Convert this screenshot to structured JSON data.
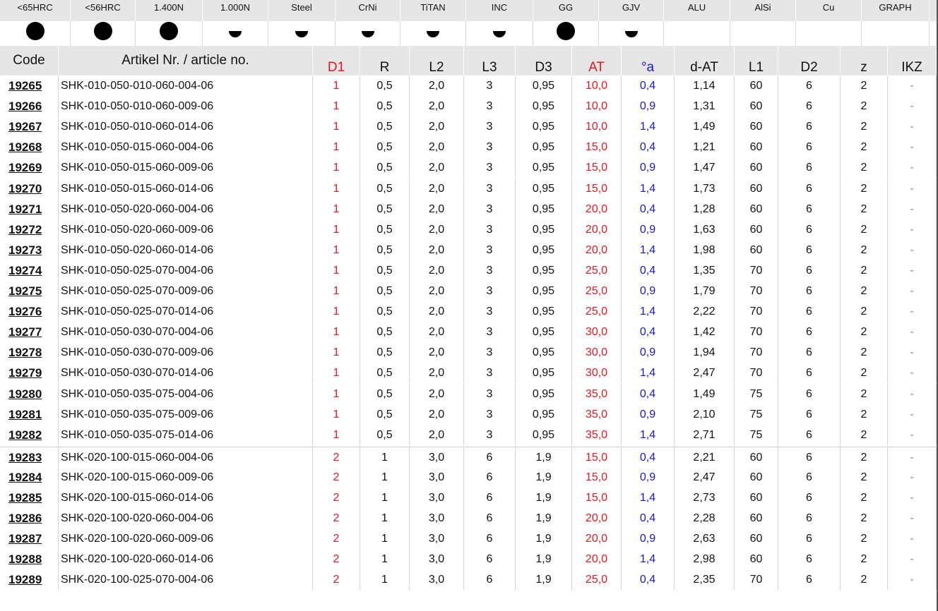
{
  "materials": [
    {
      "label": "<65HRC",
      "rating": "full"
    },
    {
      "label": "<56HRC",
      "rating": "full"
    },
    {
      "label": "1.400N",
      "rating": "full"
    },
    {
      "label": "1.000N",
      "rating": "half"
    },
    {
      "label": "Steel",
      "rating": "half"
    },
    {
      "label": "CrNi",
      "rating": "half"
    },
    {
      "label": "TiTAN",
      "rating": "half"
    },
    {
      "label": "INC",
      "rating": "half"
    },
    {
      "label": "GG",
      "rating": "full"
    },
    {
      "label": "GJV",
      "rating": "half"
    },
    {
      "label": "ALU",
      "rating": "none"
    },
    {
      "label": "AlSi",
      "rating": "none"
    },
    {
      "label": "Cu",
      "rating": "none"
    },
    {
      "label": "GRAPH",
      "rating": "none"
    }
  ],
  "columns": [
    {
      "key": "code",
      "label": "Code"
    },
    {
      "key": "article",
      "label": "Artikel Nr. / article no."
    },
    {
      "key": "d1",
      "label": "D1",
      "color": "#e8181e"
    },
    {
      "key": "r",
      "label": "R"
    },
    {
      "key": "l2",
      "label": "L2"
    },
    {
      "key": "l3",
      "label": "L3"
    },
    {
      "key": "d3",
      "label": "D3"
    },
    {
      "key": "at",
      "label": "AT",
      "color": "#e8181e"
    },
    {
      "key": "a",
      "label": "°a",
      "color": "#1616e0"
    },
    {
      "key": "dat",
      "label": "d-AT"
    },
    {
      "key": "l1",
      "label": "L1"
    },
    {
      "key": "d2",
      "label": "D2"
    },
    {
      "key": "z",
      "label": "z"
    },
    {
      "key": "ikz",
      "label": "IKZ"
    }
  ],
  "rows": [
    [
      "19265",
      "SHK-010-050-010-060-004-06",
      "1",
      "0,5",
      "2,0",
      "3",
      "0,95",
      "10,0",
      "0,4",
      "1,14",
      "60",
      "6",
      "2",
      "-"
    ],
    [
      "19266",
      "SHK-010-050-010-060-009-06",
      "1",
      "0,5",
      "2,0",
      "3",
      "0,95",
      "10,0",
      "0,9",
      "1,31",
      "60",
      "6",
      "2",
      "-"
    ],
    [
      "19267",
      "SHK-010-050-010-060-014-06",
      "1",
      "0,5",
      "2,0",
      "3",
      "0,95",
      "10,0",
      "1,4",
      "1,49",
      "60",
      "6",
      "2",
      "-"
    ],
    [
      "19268",
      "SHK-010-050-015-060-004-06",
      "1",
      "0,5",
      "2,0",
      "3",
      "0,95",
      "15,0",
      "0,4",
      "1,21",
      "60",
      "6",
      "2",
      "-"
    ],
    [
      "19269",
      "SHK-010-050-015-060-009-06",
      "1",
      "0,5",
      "2,0",
      "3",
      "0,95",
      "15,0",
      "0,9",
      "1,47",
      "60",
      "6",
      "2",
      "-"
    ],
    [
      "19270",
      "SHK-010-050-015-060-014-06",
      "1",
      "0,5",
      "2,0",
      "3",
      "0,95",
      "15,0",
      "1,4",
      "1,73",
      "60",
      "6",
      "2",
      "-"
    ],
    [
      "19271",
      "SHK-010-050-020-060-004-06",
      "1",
      "0,5",
      "2,0",
      "3",
      "0,95",
      "20,0",
      "0,4",
      "1,28",
      "60",
      "6",
      "2",
      "-"
    ],
    [
      "19272",
      "SHK-010-050-020-060-009-06",
      "1",
      "0,5",
      "2,0",
      "3",
      "0,95",
      "20,0",
      "0,9",
      "1,63",
      "60",
      "6",
      "2",
      "-"
    ],
    [
      "19273",
      "SHK-010-050-020-060-014-06",
      "1",
      "0,5",
      "2,0",
      "3",
      "0,95",
      "20,0",
      "1,4",
      "1,98",
      "60",
      "6",
      "2",
      "-"
    ],
    [
      "19274",
      "SHK-010-050-025-070-004-06",
      "1",
      "0,5",
      "2,0",
      "3",
      "0,95",
      "25,0",
      "0,4",
      "1,35",
      "70",
      "6",
      "2",
      "-"
    ],
    [
      "19275",
      "SHK-010-050-025-070-009-06",
      "1",
      "0,5",
      "2,0",
      "3",
      "0,95",
      "25,0",
      "0,9",
      "1,79",
      "70",
      "6",
      "2",
      "-"
    ],
    [
      "19276",
      "SHK-010-050-025-070-014-06",
      "1",
      "0,5",
      "2,0",
      "3",
      "0,95",
      "25,0",
      "1,4",
      "2,22",
      "70",
      "6",
      "2",
      "-"
    ],
    [
      "19277",
      "SHK-010-050-030-070-004-06",
      "1",
      "0,5",
      "2,0",
      "3",
      "0,95",
      "30,0",
      "0,4",
      "1,42",
      "70",
      "6",
      "2",
      "-"
    ],
    [
      "19278",
      "SHK-010-050-030-070-009-06",
      "1",
      "0,5",
      "2,0",
      "3",
      "0,95",
      "30,0",
      "0,9",
      "1,94",
      "70",
      "6",
      "2",
      "-"
    ],
    [
      "19279",
      "SHK-010-050-030-070-014-06",
      "1",
      "0,5",
      "2,0",
      "3",
      "0,95",
      "30,0",
      "1,4",
      "2,47",
      "70",
      "6",
      "2",
      "-"
    ],
    [
      "19280",
      "SHK-010-050-035-075-004-06",
      "1",
      "0,5",
      "2,0",
      "3",
      "0,95",
      "35,0",
      "0,4",
      "1,49",
      "75",
      "6",
      "2",
      "-"
    ],
    [
      "19281",
      "SHK-010-050-035-075-009-06",
      "1",
      "0,5",
      "2,0",
      "3",
      "0,95",
      "35,0",
      "0,9",
      "2,10",
      "75",
      "6",
      "2",
      "-"
    ],
    [
      "19282",
      "SHK-010-050-035-075-014-06",
      "1",
      "0,5",
      "2,0",
      "3",
      "0,95",
      "35,0",
      "1,4",
      "2,71",
      "75",
      "6",
      "2",
      "-"
    ],
    [
      "19283",
      "SHK-020-100-015-060-004-06",
      "2",
      "1",
      "3,0",
      "6",
      "1,9",
      "15,0",
      "0,4",
      "2,21",
      "60",
      "6",
      "2",
      "-"
    ],
    [
      "19284",
      "SHK-020-100-015-060-009-06",
      "2",
      "1",
      "3,0",
      "6",
      "1,9",
      "15,0",
      "0,9",
      "2,47",
      "60",
      "6",
      "2",
      "-"
    ],
    [
      "19285",
      "SHK-020-100-015-060-014-06",
      "2",
      "1",
      "3,0",
      "6",
      "1,9",
      "15,0",
      "1,4",
      "2,73",
      "60",
      "6",
      "2",
      "-"
    ],
    [
      "19286",
      "SHK-020-100-020-060-004-06",
      "2",
      "1",
      "3,0",
      "6",
      "1,9",
      "20,0",
      "0,4",
      "2,28",
      "60",
      "6",
      "2",
      "-"
    ],
    [
      "19287",
      "SHK-020-100-020-060-009-06",
      "2",
      "1",
      "3,0",
      "6",
      "1,9",
      "20,0",
      "0,9",
      "2,63",
      "60",
      "6",
      "2",
      "-"
    ],
    [
      "19288",
      "SHK-020-100-020-060-014-06",
      "2",
      "1",
      "3,0",
      "6",
      "1,9",
      "20,0",
      "1,4",
      "2,98",
      "60",
      "6",
      "2",
      "-"
    ],
    [
      "19289",
      "SHK-020-100-025-070-004-06",
      "2",
      "1",
      "3,0",
      "6",
      "1,9",
      "25,0",
      "0,4",
      "2,35",
      "70",
      "6",
      "2",
      "-"
    ]
  ],
  "group_breaks": [
    "19283"
  ]
}
